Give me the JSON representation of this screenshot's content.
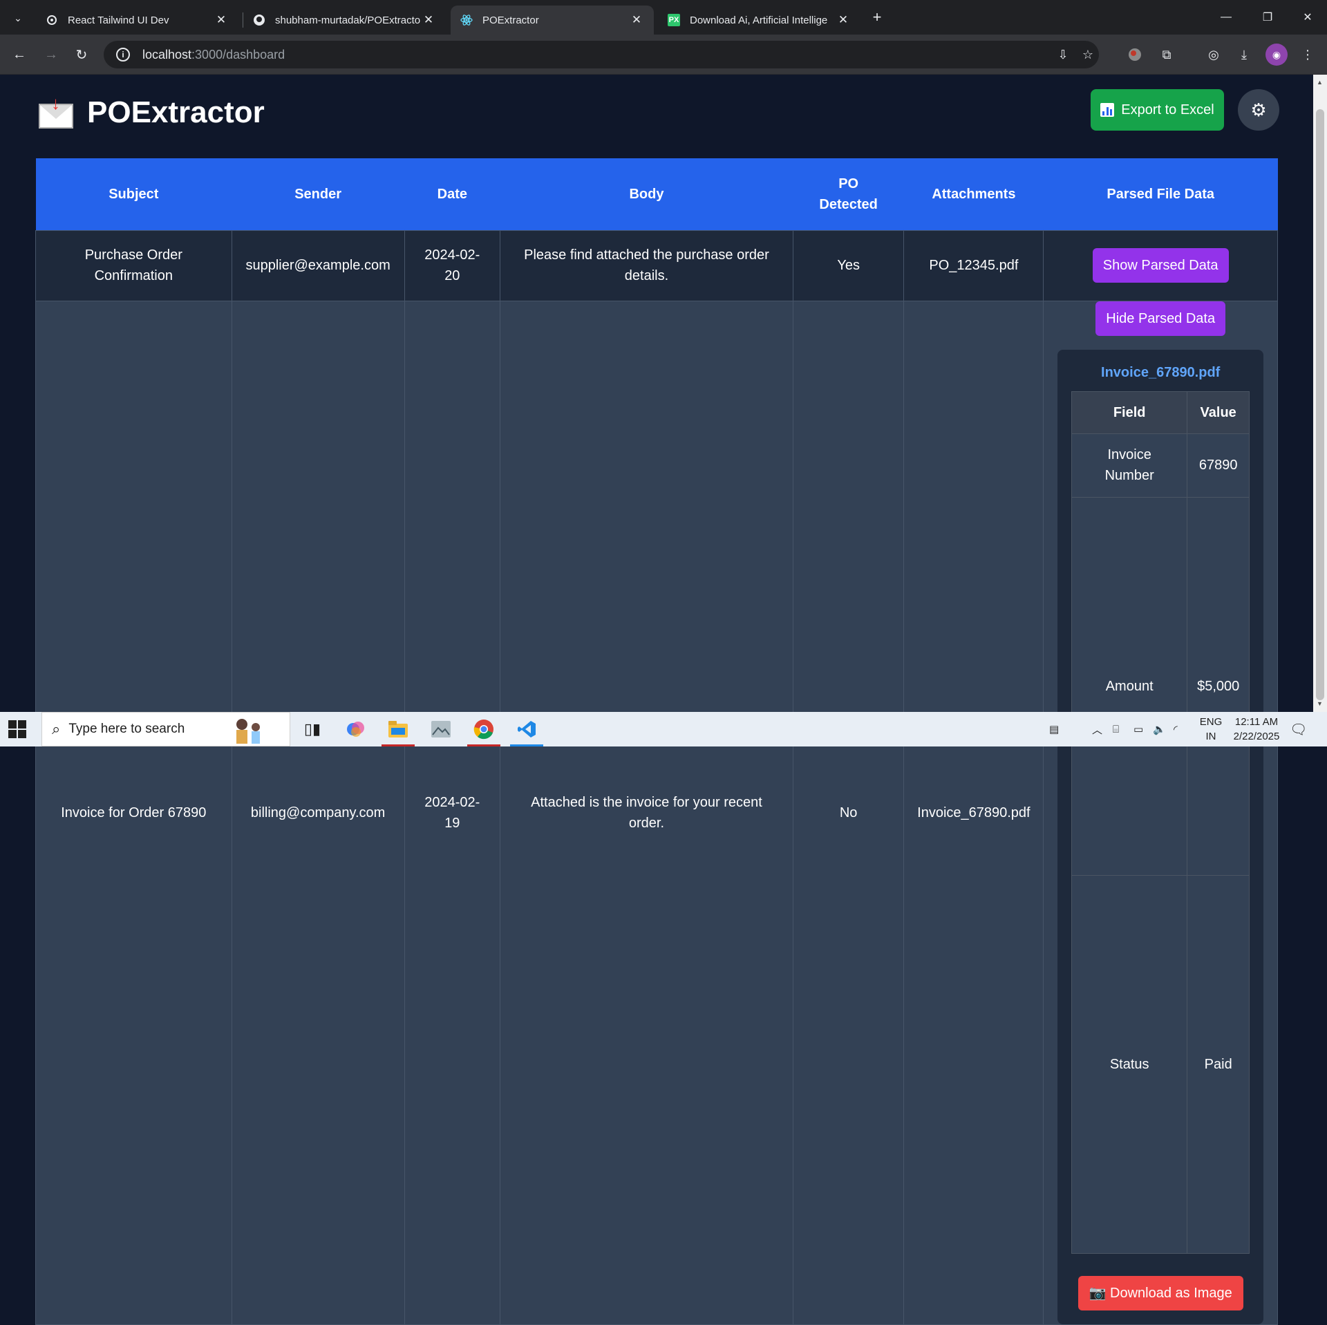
{
  "browser": {
    "tabs": [
      {
        "title": "React Tailwind UI Dev",
        "icon": "openai-icon"
      },
      {
        "title": "shubham-murtadak/POExtracto",
        "icon": "github-icon"
      },
      {
        "title": "POExtractor",
        "icon": "react-icon",
        "active": true
      },
      {
        "title": "Download Ai, Artificial Intellige",
        "icon": "pixabay-icon"
      }
    ],
    "url_host": "localhost",
    "url_path": ":3000/dashboard"
  },
  "app": {
    "title": "POExtractor",
    "export_label": "Export to Excel",
    "colors": {
      "header": "#2563eb",
      "export": "#16a34a",
      "purple": "#9333ea",
      "red": "#ef4444",
      "link": "#60a5fa"
    }
  },
  "table": {
    "headers": [
      "Subject",
      "Sender",
      "Date",
      "Body",
      "PO Detected",
      "Attachments",
      "Parsed File Data"
    ],
    "rows": [
      {
        "subject": "Purchase Order Confirmation",
        "sender": "supplier@example.com",
        "date": "2024-02-20",
        "body": "Please find attached the purchase order details.",
        "po_detected": "Yes",
        "attachments": "PO_12345.pdf",
        "action": "Show Parsed Data"
      },
      {
        "subject": "Invoice for Order 67890",
        "sender": "billing@company.com",
        "date": "2024-02-19",
        "body": "Attached is the invoice for your recent order.",
        "po_detected": "No",
        "attachments": "Invoice_67890.pdf",
        "action": "Hide Parsed Data"
      }
    ]
  },
  "parsed": {
    "file_name": "Invoice_67890.pdf",
    "col_field": "Field",
    "col_value": "Value",
    "fields": [
      {
        "field": "Invoice Number",
        "value": "67890"
      },
      {
        "field": "Amount",
        "value": "$5,000"
      },
      {
        "field": "Status",
        "value": "Paid"
      }
    ],
    "download_label": "Download as Image"
  },
  "taskbar": {
    "search_placeholder": "Type here to search",
    "lang_1": "ENG",
    "lang_2": "IN",
    "time": "12:11 AM",
    "date": "2/22/2025"
  }
}
